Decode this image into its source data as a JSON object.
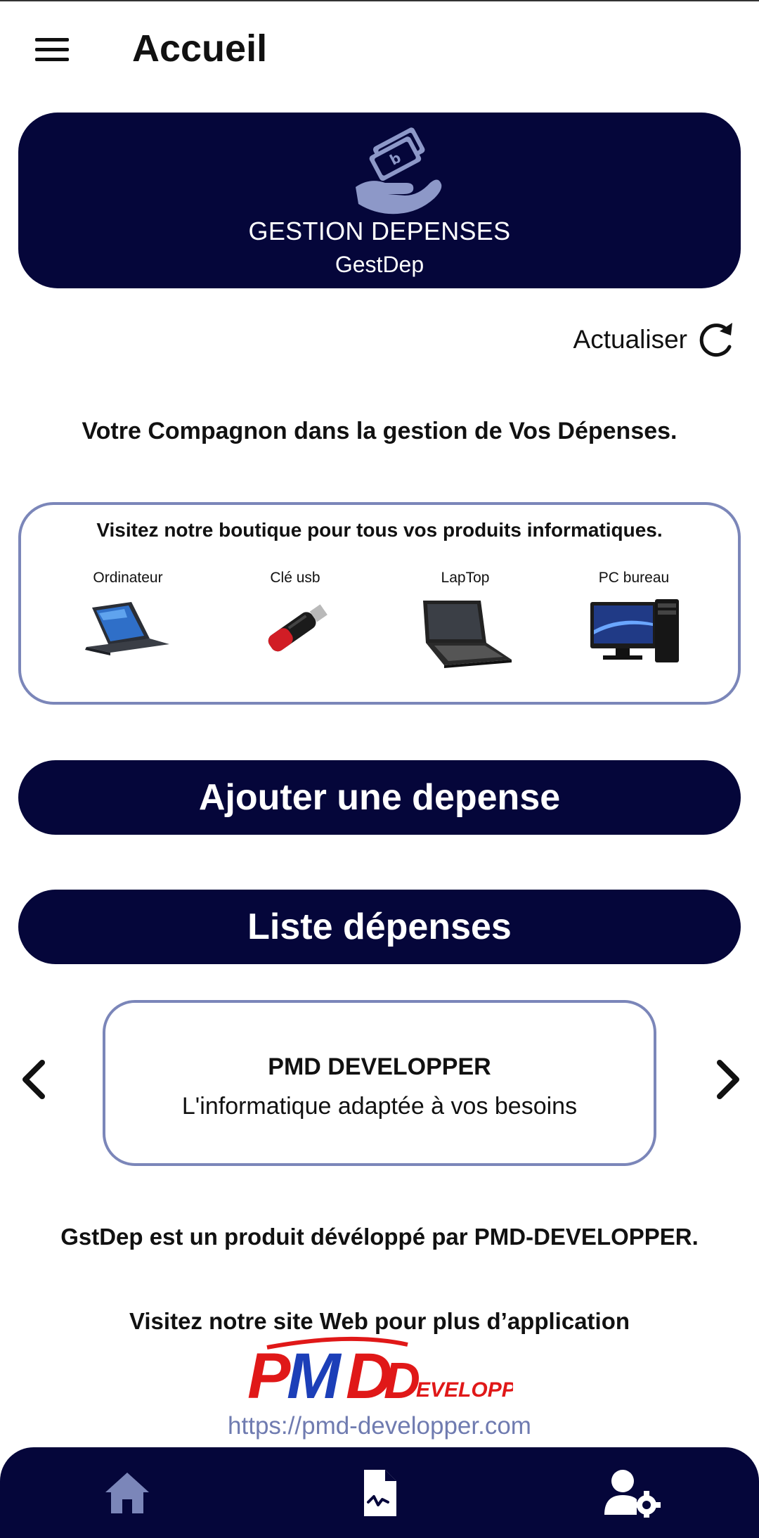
{
  "app_bar": {
    "title": "Accueil",
    "menu_icon": "hamburger-menu-icon"
  },
  "banner": {
    "logo_icon": "money-hand-icon",
    "title": "GESTION DEPENSES",
    "subtitle": "GestDep"
  },
  "refresh": {
    "label": "Actualiser",
    "icon": "refresh-icon"
  },
  "tagline": "Votre Compagnon dans la gestion de Vos Dépenses.",
  "shop": {
    "title": "Visitez notre boutique pour tous vos produits informatiques.",
    "products": [
      {
        "label": "Ordinateur",
        "icon": "tablet-laptop-icon"
      },
      {
        "label": "Clé usb",
        "icon": "usb-key-icon"
      },
      {
        "label": "LapTop",
        "icon": "laptop-icon"
      },
      {
        "label": "PC bureau",
        "icon": "desktop-pc-icon"
      }
    ]
  },
  "actions": {
    "add_expense": "Ajouter une depense",
    "list_expenses": "Liste dépenses"
  },
  "carousel": {
    "title": "PMD DEVELOPPER",
    "subtitle": "L'informatique adaptée à vos besoins",
    "prev_icon": "chevron-left-icon",
    "next_icon": "chevron-right-icon"
  },
  "footer": {
    "product_by": "GstDep est un produit dévéloppé par PMD-DEVELOPPER.",
    "visit_site": "Visitez notre site Web pour plus d’application",
    "logo_text": "PMD",
    "logo_suffix": "EVELOPPER",
    "url": "https://pmd-developper.com"
  },
  "bottom_nav": [
    {
      "icon": "home-icon"
    },
    {
      "icon": "document-icon"
    },
    {
      "icon": "user-settings-icon"
    }
  ],
  "colors": {
    "primary": "#05063a",
    "accent": "#7b86b9",
    "link": "#6f7bb0",
    "logo_red": "#e01818",
    "logo_blue": "#1c3fb8"
  }
}
